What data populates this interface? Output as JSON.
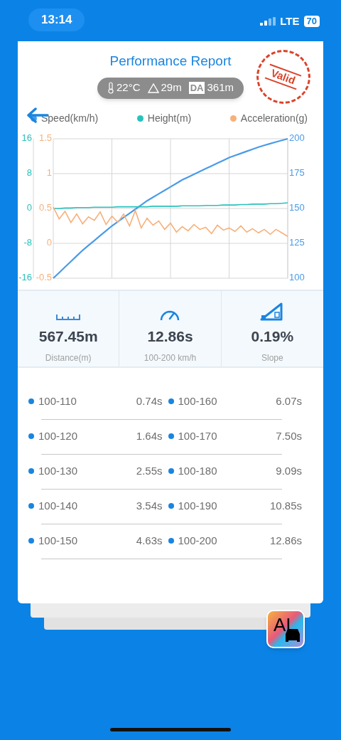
{
  "status_bar": {
    "time": "13:14",
    "network": "LTE",
    "battery": "70"
  },
  "report": {
    "title": "Performance Report",
    "stamp": "Valid",
    "conditions": [
      {
        "kind": "temperature",
        "text": "22°C"
      },
      {
        "kind": "altitude",
        "text": "29m"
      },
      {
        "kind": "density_altitude",
        "badge": "DA",
        "text": "361m"
      }
    ],
    "charts": [
      {
        "chart_data": {
          "type": "line",
          "categories": [
            null,
            null,
            null,
            null,
            null,
            null,
            null,
            null,
            null,
            null,
            null,
            null,
            null,
            null,
            null,
            null,
            null,
            null,
            null,
            null,
            null,
            null,
            null,
            null,
            null,
            null,
            null,
            null,
            null,
            null,
            null,
            null,
            null,
            null,
            null,
            null,
            null,
            null,
            null,
            null,
            null
          ],
          "ylim": [
            100,
            200
          ],
          "yticks": [
            100,
            125,
            150,
            175,
            200
          ],
          "series": [
            {
              "name": "Speed(km/h)",
              "color": "#4a9be8",
              "values": [
                100,
                104,
                108,
                112,
                116,
                120,
                123.5,
                127,
                130.5,
                134,
                137.5,
                140.5,
                143.5,
                146.5,
                149.5,
                152.5,
                155.5,
                158,
                160.5,
                163,
                165.5,
                168,
                170.5,
                172.5,
                174.5,
                176.5,
                178.5,
                180.5,
                182.5,
                184.5,
                186.5,
                188,
                189.5,
                191,
                192.5,
                194,
                195.3,
                196.5,
                197.7,
                198.9,
                200
              ]
            }
          ]
        }
      },
      {
        "chart_data": {
          "type": "line",
          "categories": [
            null,
            null,
            null,
            null,
            null,
            null,
            null,
            null,
            null,
            null,
            null,
            null,
            null,
            null,
            null,
            null,
            null,
            null,
            null,
            null,
            null,
            null,
            null,
            null,
            null,
            null,
            null,
            null,
            null,
            null,
            null,
            null,
            null,
            null,
            null,
            null,
            null,
            null,
            null,
            null,
            null
          ],
          "ylim": [
            -16,
            16
          ],
          "yticks": [
            -16,
            -8,
            0,
            8,
            16
          ],
          "series": [
            {
              "name": "Height(m)",
              "color": "#27c2bd",
              "values": [
                0,
                0,
                0.1,
                0.1,
                0.2,
                0.2,
                0.2,
                0.3,
                0.3,
                0.3,
                0.3,
                0.4,
                0.4,
                0.4,
                0.4,
                0.4,
                0.4,
                0.5,
                0.5,
                0.5,
                0.5,
                0.5,
                0.6,
                0.6,
                0.6,
                0.6,
                0.7,
                0.7,
                0.7,
                0.8,
                0.8,
                0.8,
                0.9,
                0.9,
                1,
                1,
                1,
                1.1,
                1.1,
                1.2,
                1.3
              ]
            }
          ]
        }
      },
      {
        "chart_data": {
          "type": "line",
          "categories": [
            null,
            null,
            null,
            null,
            null,
            null,
            null,
            null,
            null,
            null,
            null,
            null,
            null,
            null,
            null,
            null,
            null,
            null,
            null,
            null,
            null,
            null,
            null,
            null,
            null,
            null,
            null,
            null,
            null,
            null,
            null,
            null,
            null,
            null,
            null,
            null,
            null,
            null,
            null,
            null,
            null
          ],
          "ylim": [
            -0.5,
            1.5
          ],
          "yticks": [
            -0.5,
            0,
            0.5,
            1,
            1.5
          ],
          "series": [
            {
              "name": "Acceleration(g)",
              "color": "#f7b07a",
              "values": [
                0.52,
                0.35,
                0.46,
                0.3,
                0.42,
                0.28,
                0.38,
                0.33,
                0.45,
                0.27,
                0.39,
                0.3,
                0.42,
                0.25,
                0.47,
                0.22,
                0.36,
                0.26,
                0.32,
                0.2,
                0.29,
                0.16,
                0.24,
                0.18,
                0.27,
                0.2,
                0.23,
                0.14,
                0.26,
                0.19,
                0.22,
                0.17,
                0.25,
                0.16,
                0.21,
                0.15,
                0.2,
                0.13,
                0.2,
                0.15,
                0.1
              ]
            }
          ]
        }
      }
    ]
  },
  "stats": [
    {
      "kind": "distance",
      "value": "567.45m",
      "label": "Distance(m)"
    },
    {
      "kind": "time",
      "value": "12.86s",
      "label": "100-200 km/h"
    },
    {
      "kind": "slope",
      "value": "0.19%",
      "label": "Slope"
    }
  ],
  "splits": [
    [
      {
        "range": "100-110",
        "time": "0.74s"
      },
      {
        "range": "100-160",
        "time": "6.07s"
      }
    ],
    [
      {
        "range": "100-120",
        "time": "1.64s"
      },
      {
        "range": "100-170",
        "time": "7.50s"
      }
    ],
    [
      {
        "range": "100-130",
        "time": "2.55s"
      },
      {
        "range": "100-180",
        "time": "9.09s"
      }
    ],
    [
      {
        "range": "100-140",
        "time": "3.54s"
      },
      {
        "range": "100-190",
        "time": "10.85s"
      }
    ],
    [
      {
        "range": "100-150",
        "time": "4.63s"
      },
      {
        "range": "100-200",
        "time": "12.86s"
      }
    ]
  ],
  "ai_button": {
    "text": "AI"
  }
}
